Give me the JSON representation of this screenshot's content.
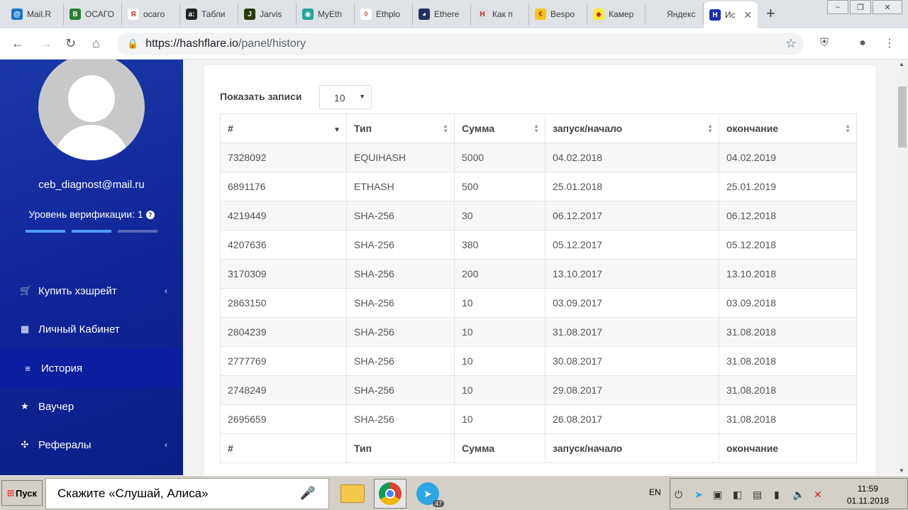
{
  "browser": {
    "tabs": [
      {
        "title": "Mail.R",
        "icon": "mail-icon",
        "color": "#1e73c9",
        "glyph": "@"
      },
      {
        "title": "ОСАГО",
        "icon": "osago-icon",
        "color": "#2e7d32",
        "glyph": "В"
      },
      {
        "title": "осаго",
        "icon": "yandex-icon",
        "color": "#ffffff",
        "glyph": "Я"
      },
      {
        "title": "Табли",
        "icon": "sheets-icon",
        "color": "#222222",
        "glyph": "a:"
      },
      {
        "title": "Jarvis",
        "icon": "jarvis-icon",
        "color": "#2a3a10",
        "glyph": "J"
      },
      {
        "title": "MyEth",
        "icon": "myeth-icon",
        "color": "#23a699",
        "glyph": "◉"
      },
      {
        "title": "Ethplo",
        "icon": "ethplorer-icon",
        "color": "#ffffff",
        "glyph": "◊"
      },
      {
        "title": "Ethere",
        "icon": "etherscan-icon",
        "color": "#21325b",
        "glyph": "◕"
      },
      {
        "title": "Как п",
        "icon": "page-icon",
        "color": "#dddddd",
        "glyph": "Н"
      },
      {
        "title": "Bespo",
        "icon": "bespoke-icon",
        "color": "#f5c518",
        "glyph": "€"
      },
      {
        "title": "Камер",
        "icon": "camera-icon",
        "color": "#ffeb3b",
        "glyph": "◆"
      },
      {
        "title": "Яндекс",
        "icon": "blank-icon",
        "color": "#dee1e6",
        "glyph": ""
      },
      {
        "title": "Ис",
        "icon": "hashflare-icon",
        "color": "#1c2fb0",
        "glyph": "H"
      }
    ],
    "active_tab_close": "✕",
    "new_tab": "+",
    "window_controls": [
      "–",
      "❐",
      "✕"
    ],
    "url_host": "https://hashflare.io",
    "url_path": "/panel/history"
  },
  "sidebar": {
    "email": "ceb_diagnost@mail.ru",
    "verification": "Уровень верификации: 1",
    "help_glyph": "?",
    "menu": [
      {
        "label": "Купить хэшрейт",
        "icon": "cart-icon",
        "glyph": "🛒",
        "chevron": "‹",
        "active": false
      },
      {
        "label": "Личный Кабинет",
        "icon": "dashboard-icon",
        "glyph": "▦",
        "chevron": "",
        "active": false
      },
      {
        "label": "История",
        "icon": "list-icon",
        "glyph": "≡",
        "chevron": "",
        "active": true
      },
      {
        "label": "Ваучер",
        "icon": "star-icon",
        "glyph": "★",
        "chevron": "",
        "active": false
      },
      {
        "label": "Рефералы",
        "icon": "network-icon",
        "glyph": "✣",
        "chevron": "‹",
        "active": false
      }
    ]
  },
  "history": {
    "show_label": "Показать записи",
    "page_size": "10",
    "columns": [
      "#",
      "Тип",
      "Сумма",
      "запуск/начало",
      "окончание"
    ],
    "rows": [
      [
        "7328092",
        "EQUIHASH",
        "5000",
        "04.02.2018",
        "04.02.2019"
      ],
      [
        "6891176",
        "ETHASH",
        "500",
        "25.01.2018",
        "25.01.2019"
      ],
      [
        "4219449",
        "SHA-256",
        "30",
        "06.12.2017",
        "06.12.2018"
      ],
      [
        "4207636",
        "SHA-256",
        "380",
        "05.12.2017",
        "05.12.2018"
      ],
      [
        "3170309",
        "SHA-256",
        "200",
        "13.10.2017",
        "13.10.2018"
      ],
      [
        "2863150",
        "SHA-256",
        "10",
        "03.09.2017",
        "03.09.2018"
      ],
      [
        "2804239",
        "SHA-256",
        "10",
        "31.08.2017",
        "31.08.2018"
      ],
      [
        "2777769",
        "SHA-256",
        "10",
        "30.08.2017",
        "31.08.2018"
      ],
      [
        "2748249",
        "SHA-256",
        "10",
        "29.08.2017",
        "31.08.2018"
      ],
      [
        "2695659",
        "SHA-256",
        "10",
        "26.08.2017",
        "31.08.2018"
      ]
    ]
  },
  "taskbar": {
    "start_label": "Пуск",
    "alice_text": "Скажите «Слушай, Алиса»",
    "telegram_badge": "47",
    "lang": "EN",
    "time": "11:59",
    "date": "01.11.2018"
  }
}
